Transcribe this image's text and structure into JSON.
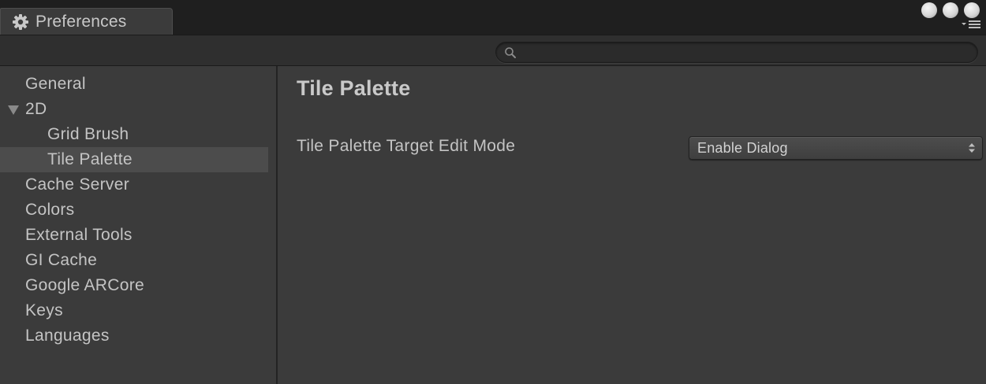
{
  "window": {
    "tab_title": "Preferences",
    "tab_icon": "gear-icon"
  },
  "search": {
    "placeholder": "",
    "value": ""
  },
  "sidebar": {
    "items": [
      {
        "label": "General",
        "indent": 0,
        "selected": false
      },
      {
        "label": "2D",
        "indent": 0,
        "expanded": true,
        "selected": false
      },
      {
        "label": "Grid Brush",
        "indent": 1,
        "selected": false
      },
      {
        "label": "Tile Palette",
        "indent": 1,
        "selected": true
      },
      {
        "label": "Cache Server",
        "indent": 0,
        "selected": false
      },
      {
        "label": "Colors",
        "indent": 0,
        "selected": false
      },
      {
        "label": "External Tools",
        "indent": 0,
        "selected": false
      },
      {
        "label": "GI Cache",
        "indent": 0,
        "selected": false
      },
      {
        "label": "Google ARCore",
        "indent": 0,
        "selected": false
      },
      {
        "label": "Keys",
        "indent": 0,
        "selected": false
      },
      {
        "label": "Languages",
        "indent": 0,
        "selected": false
      }
    ]
  },
  "main": {
    "title": "Tile Palette",
    "settings": [
      {
        "label": "Tile Palette Target Edit Mode",
        "value": "Enable Dialog"
      }
    ]
  },
  "colors": {
    "background": "#3b3b3b",
    "tabbar": "#1f1f1f",
    "selected_row": "#4c4c4c",
    "text": "#c4c4c4"
  }
}
